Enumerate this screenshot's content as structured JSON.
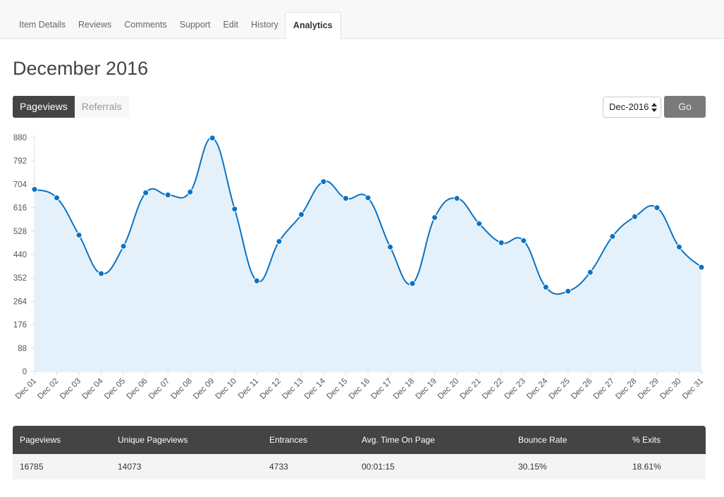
{
  "tabs": [
    {
      "label": "Item Details",
      "active": false
    },
    {
      "label": "Reviews",
      "active": false
    },
    {
      "label": "Comments",
      "active": false
    },
    {
      "label": "Support",
      "active": false
    },
    {
      "label": "Edit",
      "active": false
    },
    {
      "label": "History",
      "active": false
    },
    {
      "label": "Analytics",
      "active": true
    }
  ],
  "page_title": "December 2016",
  "toggle": {
    "pageviews_label": "Pageviews",
    "referrals_label": "Referrals",
    "selected": "Pageviews"
  },
  "month_select": {
    "value": "Dec-2016"
  },
  "go_label": "Go",
  "colors": {
    "line": "#0a72c4",
    "area": "#e5f1fa",
    "header_bg": "#444444"
  },
  "chart_data": {
    "type": "area",
    "title": "",
    "xlabel": "",
    "ylabel": "",
    "categories": [
      "Dec 01",
      "Dec 02",
      "Dec 03",
      "Dec 04",
      "Dec 05",
      "Dec 06",
      "Dec 07",
      "Dec 08",
      "Dec 09",
      "Dec 10",
      "Dec 11",
      "Dec 12",
      "Dec 13",
      "Dec 14",
      "Dec 15",
      "Dec 16",
      "Dec 17",
      "Dec 18",
      "Dec 19",
      "Dec 20",
      "Dec 21",
      "Dec 22",
      "Dec 23",
      "Dec 24",
      "Dec 25",
      "Dec 26",
      "Dec 27",
      "Dec 28",
      "Dec 29",
      "Dec 30",
      "Dec 31"
    ],
    "series": [
      {
        "name": "Pageviews",
        "values": [
          685,
          653,
          513,
          368,
          471,
          672,
          664,
          675,
          878,
          611,
          341,
          489,
          590,
          714,
          651,
          653,
          468,
          331,
          579,
          651,
          556,
          484,
          492,
          317,
          302,
          373,
          508,
          582,
          616,
          468,
          392
        ]
      }
    ],
    "yticks": [
      0,
      88,
      176,
      264,
      352,
      440,
      528,
      616,
      704,
      792,
      880
    ],
    "ylim": [
      0,
      880
    ],
    "grid": false,
    "legend": "none"
  },
  "stats_table": {
    "headers": [
      "Pageviews",
      "Unique Pageviews",
      "Entrances",
      "Avg. Time On Page",
      "Bounce Rate",
      "% Exits"
    ],
    "rows": [
      [
        "16785",
        "14073",
        "4733",
        "00:01:15",
        "30.15%",
        "18.61%"
      ]
    ]
  }
}
